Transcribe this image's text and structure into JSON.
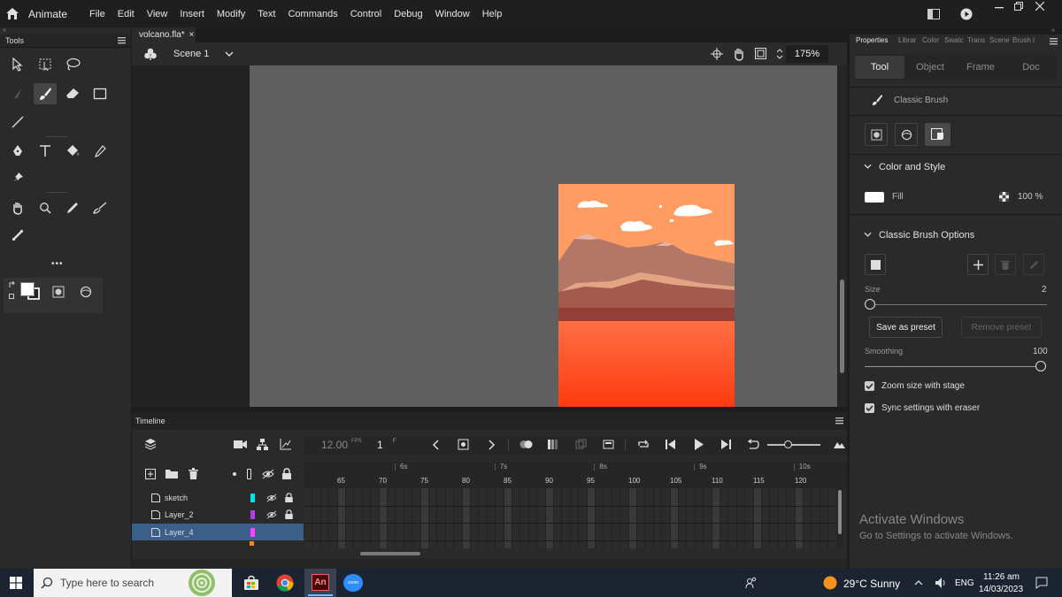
{
  "app": {
    "name": "Animate"
  },
  "menu": [
    "File",
    "Edit",
    "View",
    "Insert",
    "Modify",
    "Text",
    "Commands",
    "Control",
    "Debug",
    "Window",
    "Help"
  ],
  "tools_panel": {
    "title": "Tools",
    "more": "•••"
  },
  "document": {
    "tab": "volcano.fla*",
    "tab_close": "×",
    "scene": "Scene 1",
    "zoom": "175%"
  },
  "timeline": {
    "title": "Timeline",
    "fps": "12.00",
    "fps_unit": "FPS",
    "frame": "1",
    "frame_unit": "F",
    "seconds": [
      "6s",
      "7s",
      "8s",
      "9s",
      "10s"
    ],
    "frames": [
      "65",
      "70",
      "75",
      "80",
      "85",
      "90",
      "95",
      "100",
      "105",
      "110",
      "115",
      "120"
    ],
    "layers": [
      {
        "name": "sketch",
        "color": "#00e5e5"
      },
      {
        "name": "Layer_2",
        "color": "#b040e0"
      },
      {
        "name": "Layer_4",
        "color": "#ff44ff"
      }
    ]
  },
  "properties": {
    "tabs": [
      "Properties",
      "Librar",
      "Color",
      "Swatc",
      "Trans",
      "Scene",
      "Brush l"
    ],
    "segments": [
      "Tool",
      "Object",
      "Frame",
      "Doc"
    ],
    "tool_name": "Classic Brush",
    "color_style": {
      "title": "Color and Style",
      "fill_label": "Fill",
      "fill_color": "#ffffff",
      "alpha": "100 %"
    },
    "brush_options": {
      "title": "Classic Brush Options",
      "size_label": "Size",
      "size_value": "2",
      "save_preset": "Save as preset",
      "remove_preset": "Remove preset",
      "smoothing_label": "Smoothing",
      "smoothing_value": "100",
      "zoom_size": "Zoom size with stage",
      "sync_eraser": "Sync settings with eraser"
    },
    "activate_title": "Activate Windows",
    "activate_sub": "Go to Settings to activate Windows."
  },
  "taskbar": {
    "search_placeholder": "Type here to search",
    "weather": "29°C  Sunny",
    "lang": "ENG",
    "time": "11:26 am",
    "date": "14/03/2023",
    "animate_label": "An",
    "zoom_label": "zoom"
  }
}
